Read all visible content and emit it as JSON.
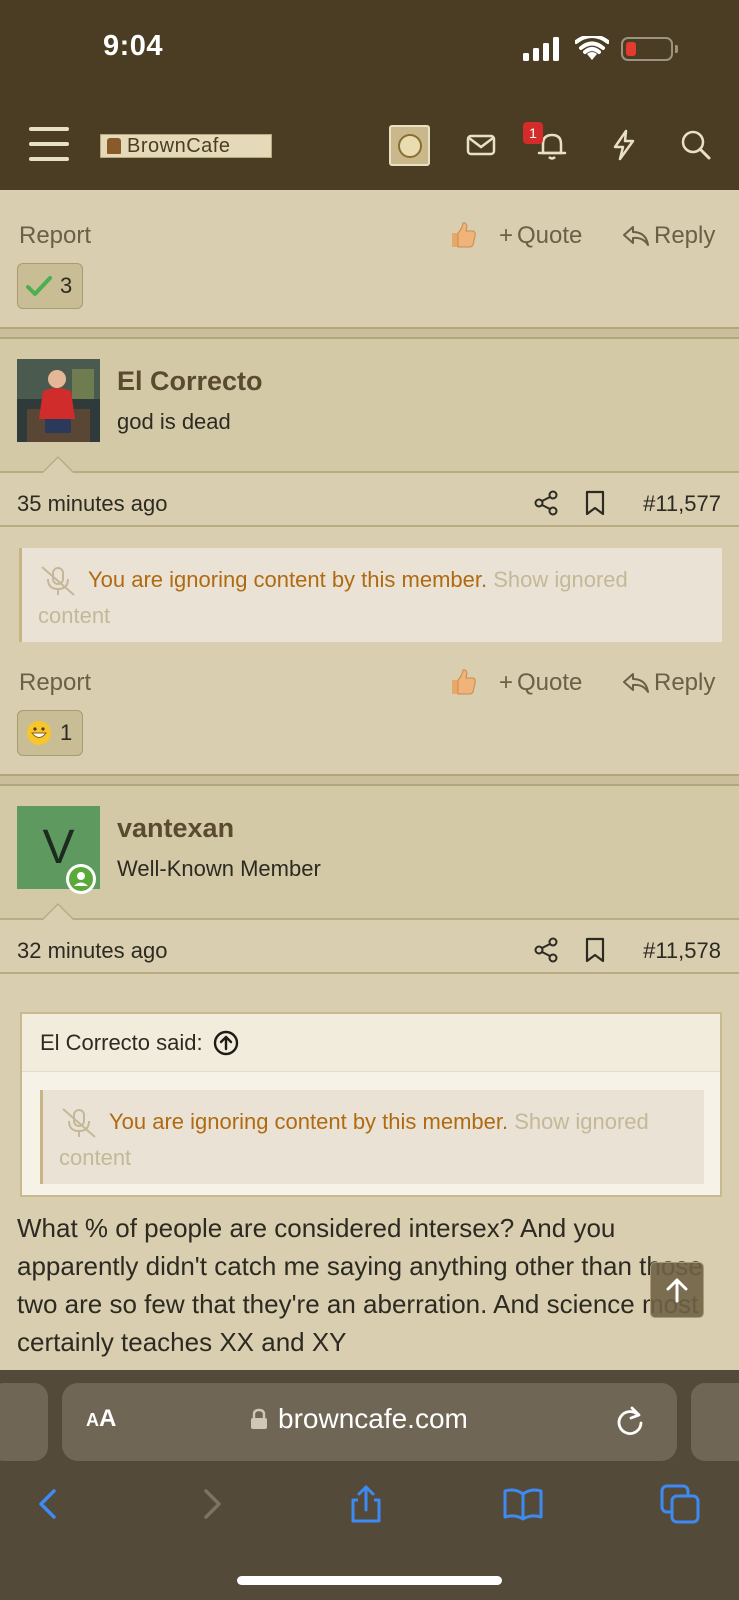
{
  "status_bar": {
    "time": "9:04"
  },
  "header": {
    "logo_text": "BrownCafe",
    "alerts_badge": "1",
    "icons": [
      "menu-icon",
      "avatar",
      "mail-icon",
      "bell-icon",
      "lightning-icon",
      "search-icon"
    ]
  },
  "post_actions_top": {
    "report": "Report",
    "quote": "Quote",
    "reply": "Reply",
    "reaction_count": "3",
    "reaction_icon": "checkmark-icon"
  },
  "posts": [
    {
      "author": "El Correcto",
      "subtitle": "god is dead",
      "time": "35 minutes ago",
      "number": "#11,577",
      "ignored_text": "You are ignoring content by this member.",
      "show_ignored": "Show ignored content",
      "actions": {
        "report": "Report",
        "quote": "Quote",
        "reply": "Reply",
        "reaction_count": "1",
        "reaction_icon": "grin-icon"
      }
    },
    {
      "author": "vantexan",
      "avatar_letter": "V",
      "subtitle": "Well-Known Member",
      "time": "32 minutes ago",
      "number": "#11,578",
      "quote_author": "El Correcto said:",
      "ignored_text": "You are ignoring content by this member.",
      "show_ignored": "Show ignored content",
      "body": "What % of people are considered intersex? And you apparently didn't catch me saying anything other than those two are so few that they're an aberration. And science most certainly teaches XX and XY"
    }
  ],
  "safari": {
    "aa_small": "A",
    "aa_large": "A",
    "url": "browncafe.com"
  },
  "colors": {
    "header_bg": "#4a3d24",
    "page_bg": "#d9cfb0",
    "ignored_text": "#b06a12",
    "accent_blue": "#3d8bf2"
  }
}
